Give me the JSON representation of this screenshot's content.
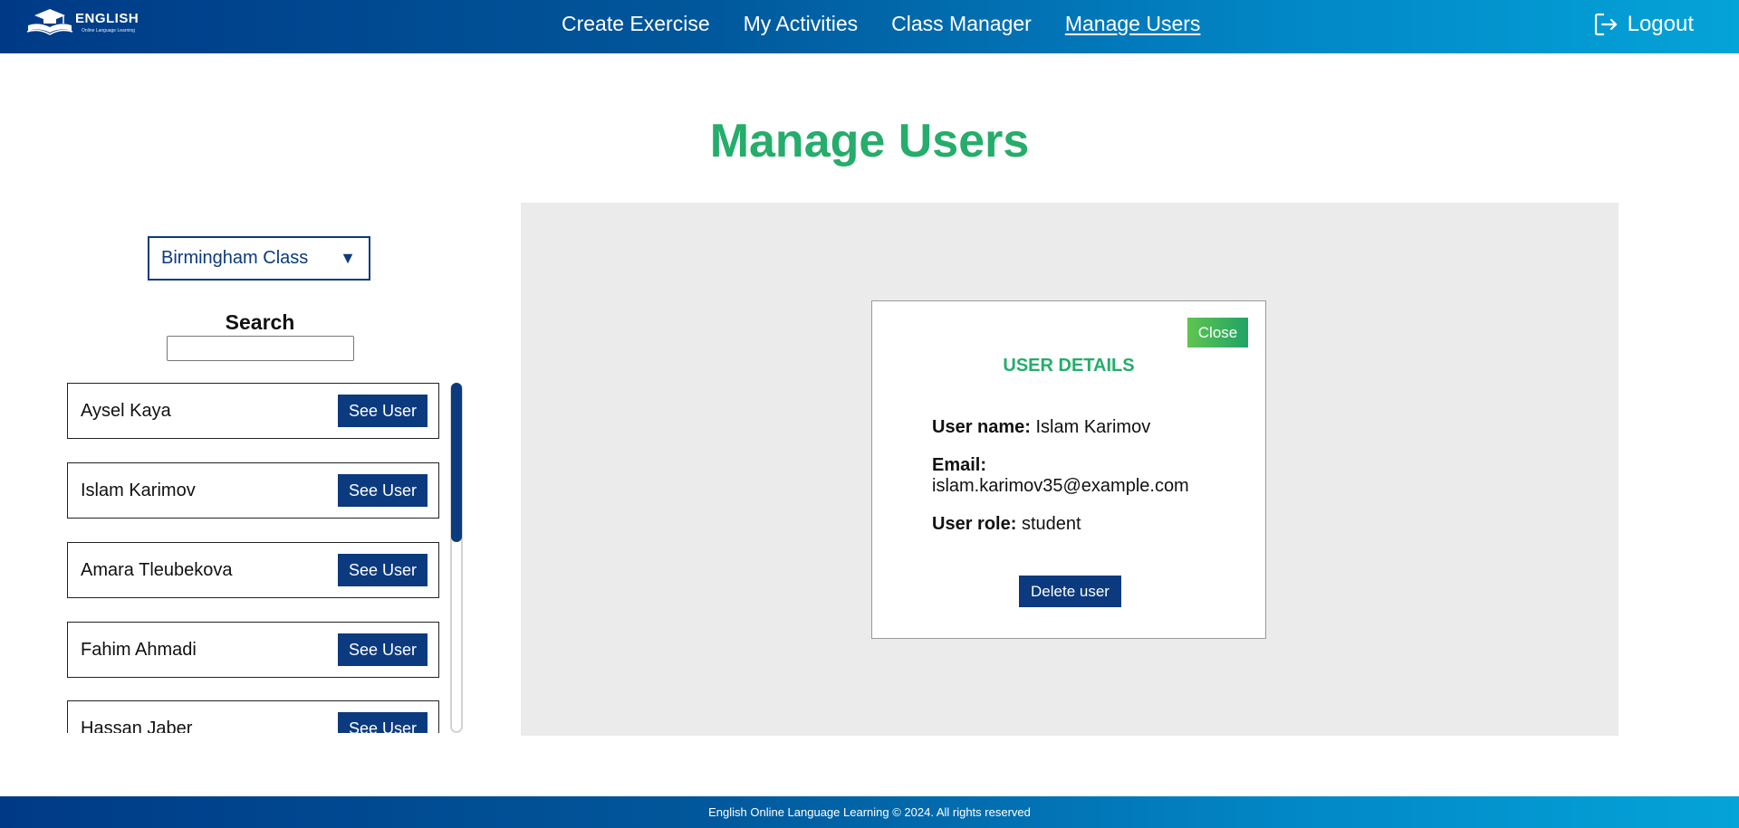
{
  "header": {
    "logo_title": "ENGLISH",
    "logo_subtitle": "Online Language Learning",
    "nav": [
      {
        "label": "Create Exercise",
        "active": false
      },
      {
        "label": "My Activities",
        "active": false
      },
      {
        "label": "Class Manager",
        "active": false
      },
      {
        "label": "Manage Users",
        "active": true
      }
    ],
    "logout_label": "Logout"
  },
  "page": {
    "title": "Manage Users"
  },
  "sidebar": {
    "class_select": {
      "selected": "Birmingham Class",
      "arrow": "▼"
    },
    "search_label": "Search",
    "search_value": "",
    "users": [
      {
        "name": "Aysel Kaya",
        "button": "See User"
      },
      {
        "name": "Islam Karimov",
        "button": "See User"
      },
      {
        "name": "Amara Tleubekova",
        "button": "See User"
      },
      {
        "name": "Fahim Ahmadi",
        "button": "See User"
      },
      {
        "name": "Hassan Jaber",
        "button": "See User"
      }
    ]
  },
  "details": {
    "close_label": "Close",
    "title": "USER DETAILS",
    "username_label": "User name:",
    "username_value": "Islam Karimov",
    "email_label": "Email:",
    "email_value": "islam.karimov35@example.com",
    "role_label": "User role:",
    "role_value": "student",
    "delete_label": "Delete user"
  },
  "footer": {
    "text": "English Online Language Learning © 2024. All rights reserved"
  },
  "colors": {
    "brand_blue": "#0b3a7e",
    "title_green": "#25ad6b",
    "panel_gray": "#ebebeb"
  }
}
